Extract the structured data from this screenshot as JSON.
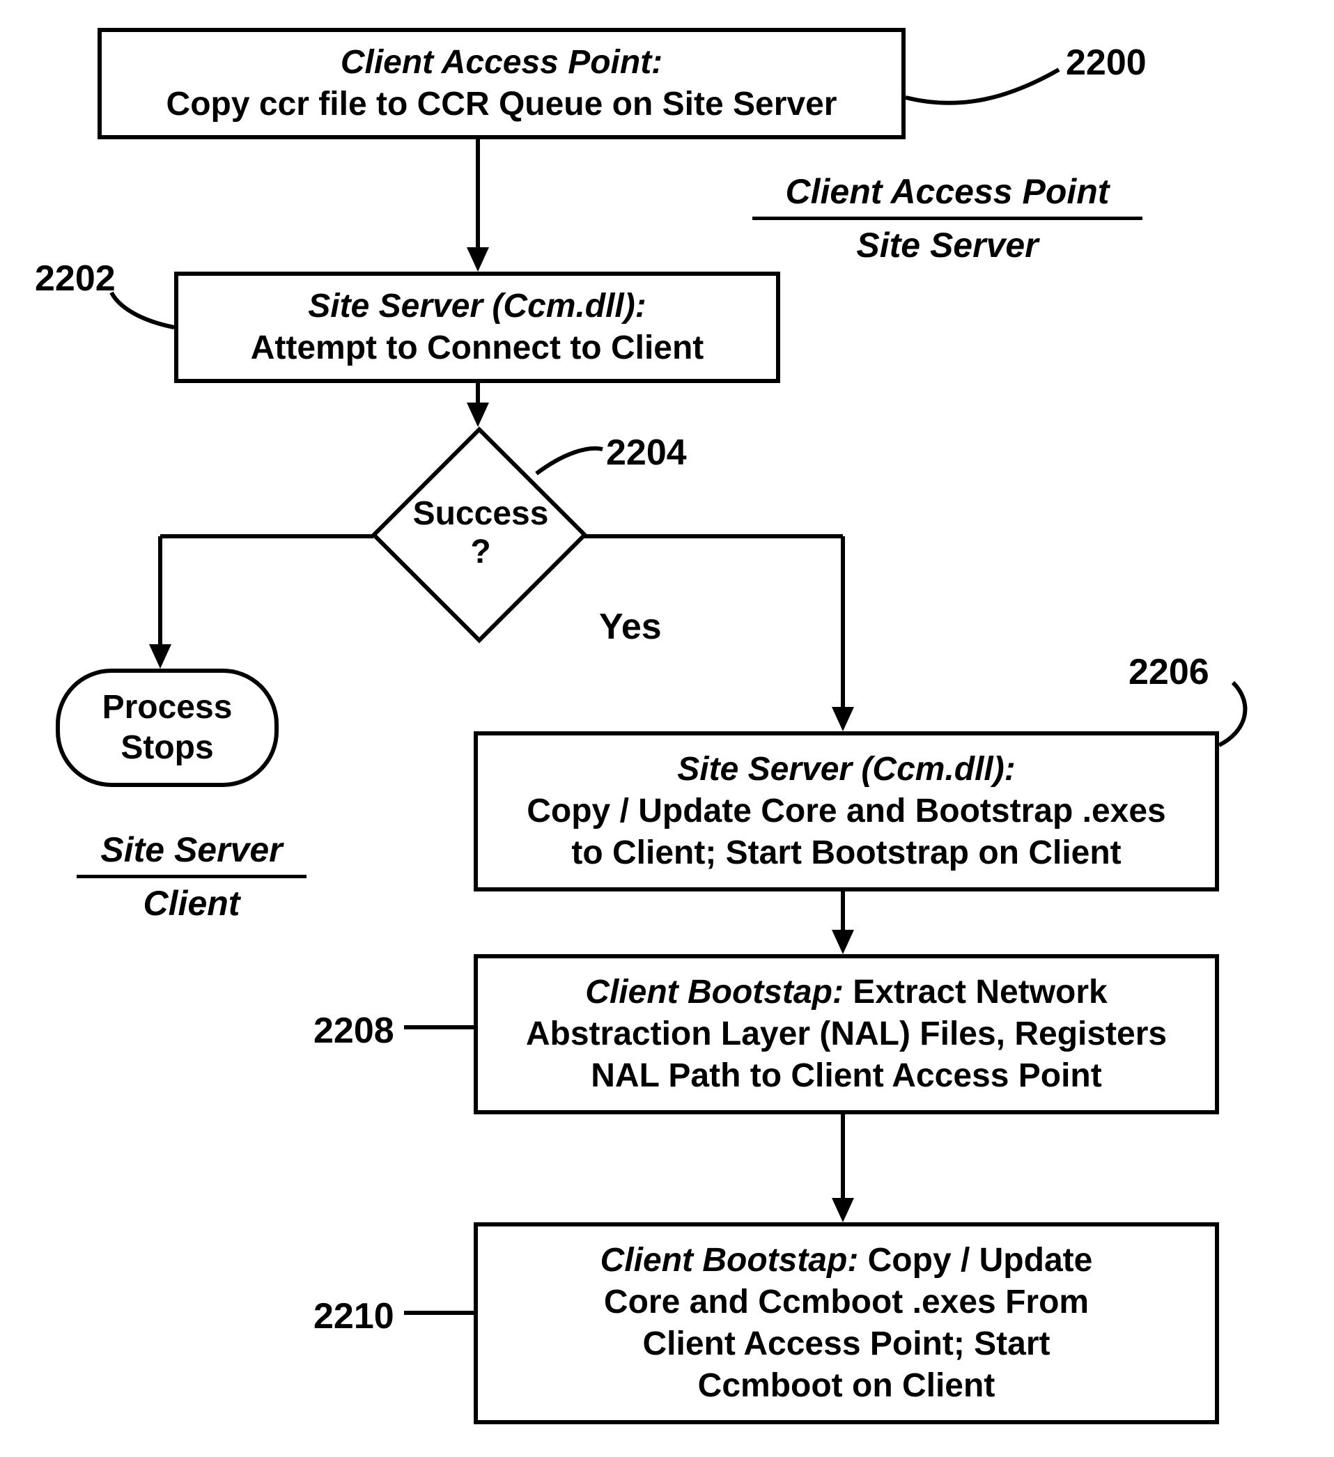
{
  "refs": {
    "r2200": "2200",
    "r2202": "2202",
    "r2204": "2204",
    "r2206": "2206",
    "r2208": "2208",
    "r2210": "2210"
  },
  "context1": {
    "top": "Client Access Point",
    "bottom": "Site Server"
  },
  "context2": {
    "top": "Site Server",
    "bottom": "Client"
  },
  "node2200": {
    "title": "Client Access Point:",
    "body": "Copy ccr file to CCR Queue on Site Server"
  },
  "node2202": {
    "title": "Site Server (Ccm.dll):",
    "body": "Attempt to Connect to Client"
  },
  "decision": {
    "line1": "Success",
    "line2": "?",
    "yes": "Yes"
  },
  "terminator": {
    "line1": "Process",
    "line2": "Stops"
  },
  "node2206": {
    "title": "Site Server (Ccm.dll):",
    "body1": "Copy / Update Core and Bootstrap .exes",
    "body2": "to Client; Start Bootstrap on Client"
  },
  "node2208": {
    "titleInline": "Client Bootstap:",
    "body1": " Extract Network",
    "body2": "Abstraction Layer (NAL) Files, Registers",
    "body3": "NAL Path to Client Access Point"
  },
  "node2210": {
    "titleInline": "Client Bootstap:",
    "body1": " Copy / Update",
    "body2": "Core and Ccmboot .exes  From",
    "body3": "Client Access Point; Start",
    "body4": "Ccmboot on Client"
  }
}
